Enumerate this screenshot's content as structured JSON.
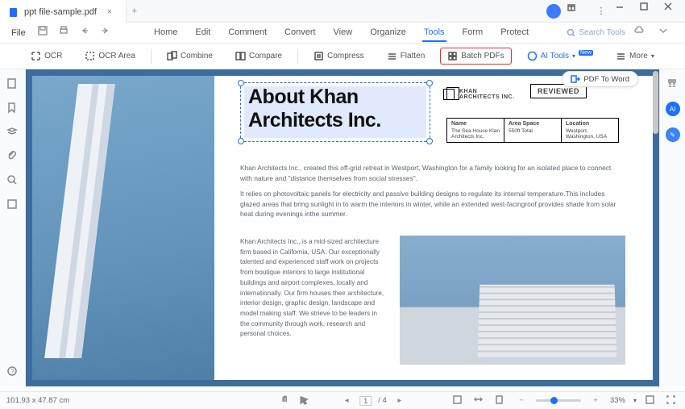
{
  "title_tab": "ppt file-sample.pdf",
  "file_menu": "File",
  "menu": {
    "home": "Home",
    "edit": "Edit",
    "comment": "Comment",
    "convert": "Convert",
    "view": "View",
    "organize": "Organize",
    "tools": "Tools",
    "form": "Form",
    "protect": "Protect"
  },
  "search_placeholder": "Search Tools",
  "toolbar": {
    "ocr": "OCR",
    "ocr_area": "OCR Area",
    "combine": "Combine",
    "compare": "Compare",
    "compress": "Compress",
    "flatten": "Flatten",
    "batch": "Batch PDFs",
    "ai": "AI Tools",
    "more": "More",
    "new": "New"
  },
  "pdf_to_word": "PDF To Word",
  "doc": {
    "title_l1": "About Khan",
    "title_l2": "Architects Inc.",
    "logo_l1": "KHAN",
    "logo_l2": "ARCHITECTS INC.",
    "reviewed": "REVIEWED",
    "table": {
      "c1h": "Name",
      "c1v": "The Sea House Klan Architects Inc.",
      "c2h": "Area Space",
      "c2v": "550ft Total",
      "c3h": "Location",
      "c3v": "Westport, Washington, USA"
    },
    "p1": "Khan Architects Inc., created this off-grid retreat in Westport, Washington for a family looking for an isolated place to connect with nature and \"distance themselves from social stresses\".",
    "p2": "It relies on photovoltaic panels for electricity and passive building designs to regulate its internal temperature.This includes glazed areas that bring sunlight in to warm the interiors in winter, while an extended west-facingroof provides shade from solar heat during evenings inthe summer.",
    "col": "Khan Architects Inc., is a mid-sized architecture firm based in California, USA. Our exceptionally talented and experienced staff work on projects from boutique interiors to large institutional buildings and airport complexes, locally and internationally. Our firm houses their architecture, interior design, graphic design, landscape and model making staff. We strieve to be leaders in the community through work, research and personal choices."
  },
  "status": {
    "coords": "101.93 x 47.87 cm",
    "page_cur": "1",
    "page_total": "/ 4",
    "zoom": "33%"
  }
}
